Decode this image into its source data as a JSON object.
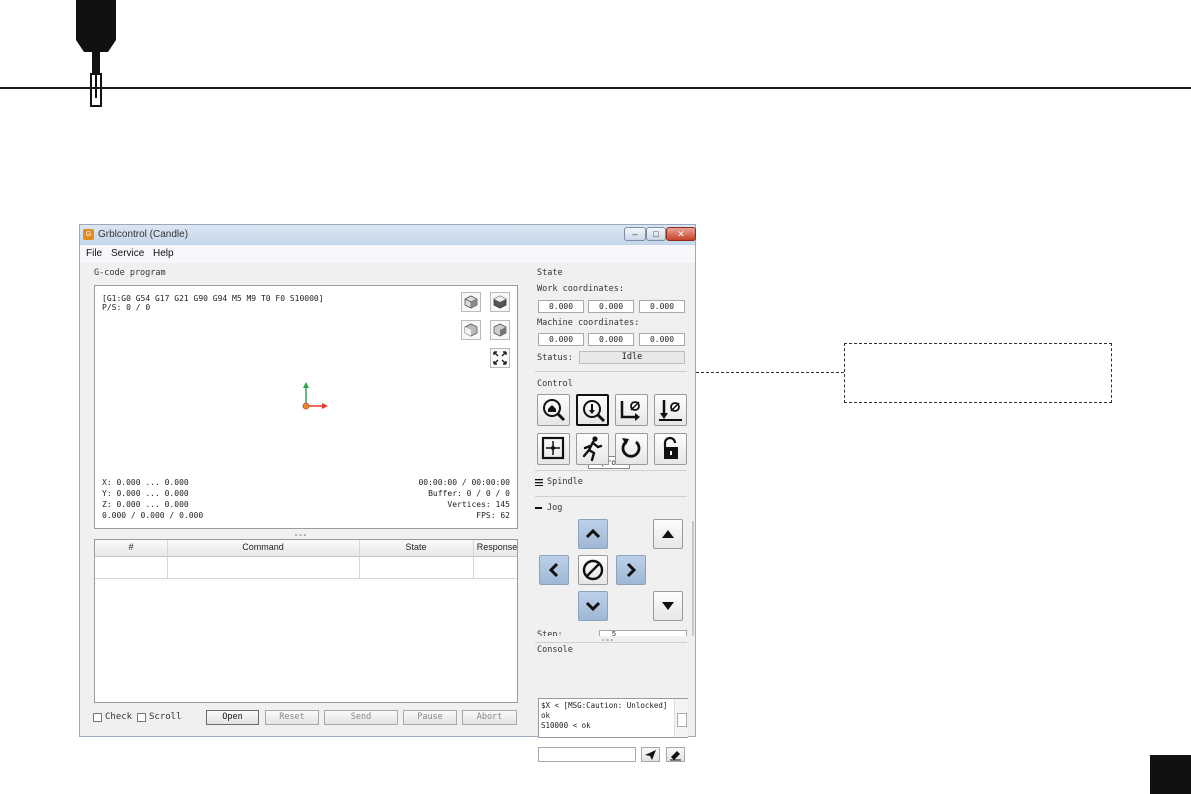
{
  "window": {
    "title": "Grblcontrol (Candle)",
    "icon_letter": "G",
    "min_glyph": "–",
    "max_glyph": "□",
    "close_glyph": "✕"
  },
  "menu": [
    "File",
    "Service",
    "Help"
  ],
  "gcode": {
    "group_title": "G-code program",
    "state_line": "[G1:G0 G54 G17 G21 G90 G94 M5 M9 T0 F0 S10000]",
    "ps_line": "P/S: 0 / 0",
    "x_line": "X: 0.000 ... 0.000",
    "y_line": "Y: 0.000 ... 0.000",
    "z_line": "Z: 0.000 ... 0.000",
    "size_line": "0.000 / 0.000 / 0.000",
    "time_line": "00:00:00 / 00:00:00",
    "buffer_line": "Buffer: 0 / 0 / 0",
    "vertices_line": "Vertices: 145",
    "fps_line": "FPS: 62",
    "splitter": "∘∘∘"
  },
  "table": {
    "headers": [
      "#",
      "Command",
      "State",
      "Response"
    ]
  },
  "bottom": {
    "check_label": "Check",
    "scroll_label": "Scroll",
    "open": "Open",
    "reset": "Reset",
    "send": "Send",
    "pause": "Pause",
    "abort": "Abort"
  },
  "state": {
    "group_title": "State",
    "work_label": "Work coordinates:",
    "work": [
      "0.000",
      "0.000",
      "0.000"
    ],
    "machine_label": "Machine coordinates:",
    "machine": [
      "0.000",
      "0.000",
      "0.000"
    ],
    "status_label": "Status:",
    "status_value": "Idle"
  },
  "control": {
    "group_title": "Control",
    "tooltip": "Z-probe"
  },
  "spindle": {
    "title": "Spindle"
  },
  "jog": {
    "title": "Jog",
    "step_label": "Step:",
    "step_value": "5"
  },
  "console": {
    "title": "Console",
    "lines": [
      "$X < [MSG:Caution: Unlocked]",
      "ok",
      "S10000 < ok"
    ]
  },
  "colors": {
    "jog_blue": "#a9c0dd",
    "title_bar": "#c5d6ea",
    "accent_red": "#e23b2c",
    "accent_green": "#2aa84a"
  }
}
